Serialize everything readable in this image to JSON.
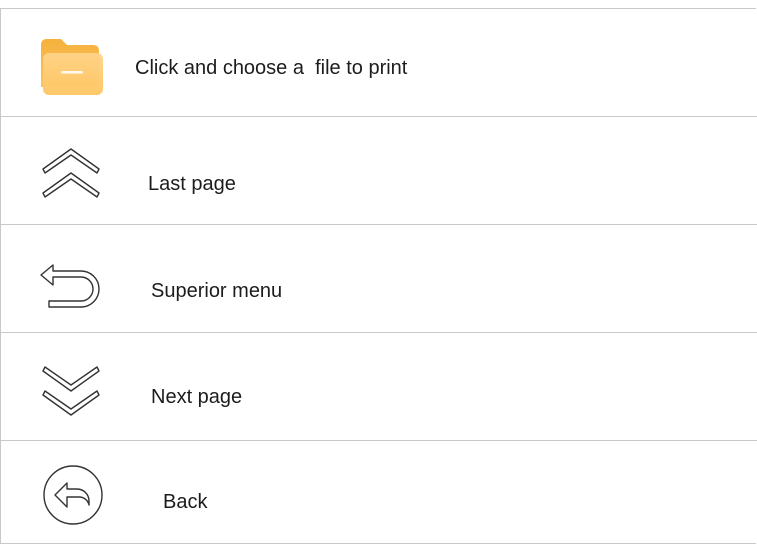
{
  "menu": {
    "items": [
      {
        "id": "file",
        "label": "Click and choose a  file to print",
        "icon": "folder-icon"
      },
      {
        "id": "last",
        "label": "Last page",
        "icon": "double-chevron-up-icon"
      },
      {
        "id": "superior",
        "label": "Superior menu",
        "icon": "return-arrow-icon"
      },
      {
        "id": "next",
        "label": "Next page",
        "icon": "double-chevron-down-icon"
      },
      {
        "id": "back",
        "label": "Back",
        "icon": "back-circle-icon"
      }
    ]
  },
  "colors": {
    "folder_back": "#f7b84b",
    "folder_front": "#ffcf7a",
    "divider": "#c8c8c8",
    "text": "#1c1c1c",
    "icon_stroke": "#333333"
  }
}
